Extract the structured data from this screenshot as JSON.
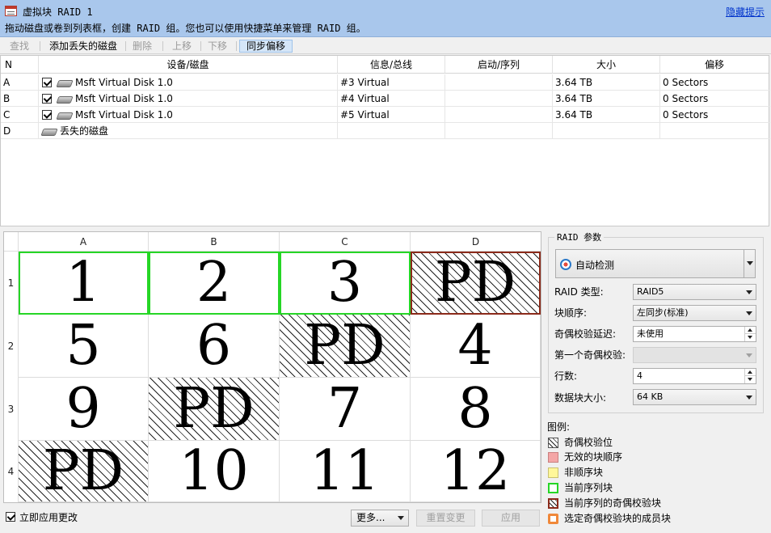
{
  "header": {
    "title": "虚拟块 RAID 1",
    "hint": "拖动磁盘或卷到列表框，创建 RAID 组。您也可以使用快捷菜单来管理 RAID 组。",
    "hide_hints": "隐藏提示"
  },
  "toolbar": {
    "find": "查找",
    "add_missing": "添加丢失的磁盘",
    "delete": "删除",
    "move_up": "上移",
    "move_down": "下移",
    "sync_offset": "同步偏移"
  },
  "disk_table": {
    "columns": [
      "N",
      "设备/磁盘",
      "信息/总线",
      "启动/序列",
      "大小",
      "偏移"
    ],
    "rows": [
      {
        "n": "A",
        "device": "Msft Virtual Disk 1.0",
        "info": "#3 Virtual",
        "start": "",
        "size": "3.64 TB",
        "offset": "0 Sectors"
      },
      {
        "n": "B",
        "device": "Msft Virtual Disk 1.0",
        "info": "#4 Virtual",
        "start": "",
        "size": "3.64 TB",
        "offset": "0 Sectors"
      },
      {
        "n": "C",
        "device": "Msft Virtual Disk 1.0",
        "info": "#5 Virtual",
        "start": "",
        "size": "3.64 TB",
        "offset": "0 Sectors"
      },
      {
        "n": "D",
        "device": "丢失的磁盘",
        "info": "",
        "start": "",
        "size": "",
        "offset": ""
      }
    ]
  },
  "grid": {
    "col_headers": [
      "A",
      "B",
      "C",
      "D"
    ],
    "row_headers": [
      "1",
      "2",
      "3",
      "4"
    ],
    "cells": [
      [
        "1",
        "2",
        "3",
        "PD"
      ],
      [
        "5",
        "6",
        "PD",
        "4"
      ],
      [
        "9",
        "PD",
        "7",
        "8"
      ],
      [
        "PD",
        "10",
        "11",
        "12"
      ]
    ]
  },
  "params": {
    "title": "RAID 参数",
    "autodetect": "自动检测",
    "raid_type_label": "RAID 类型:",
    "raid_type": "RAID5",
    "block_order_label": "块顺序:",
    "block_order": "左同步(标准)",
    "parity_delay_label": "奇偶校验延迟:",
    "parity_delay": "未使用",
    "first_parity_label": "第一个奇偶校验:",
    "first_parity": "",
    "rows_label": "行数:",
    "rows": "4",
    "stripe_size_label": "数据块大小:",
    "stripe_size": "64 KB"
  },
  "legend": {
    "title": "图例:",
    "items": [
      "奇偶校验位",
      "无效的块顺序",
      "非顺序块",
      "当前序列块",
      "当前序列的奇偶校验块",
      "选定奇偶校验块的成员块"
    ]
  },
  "bottom": {
    "apply_immediately": "立即应用更改",
    "more": "更多...",
    "reset": "重置变更",
    "apply": "应用"
  },
  "colors": {
    "header_bg": "#a9c7ec",
    "sequence_green": "#26d626",
    "parity_seq_border": "#8b2a1a",
    "invalid_order": "#f4a6a6",
    "non_sequential": "#fff79a",
    "selected_member": "#f0883a"
  }
}
